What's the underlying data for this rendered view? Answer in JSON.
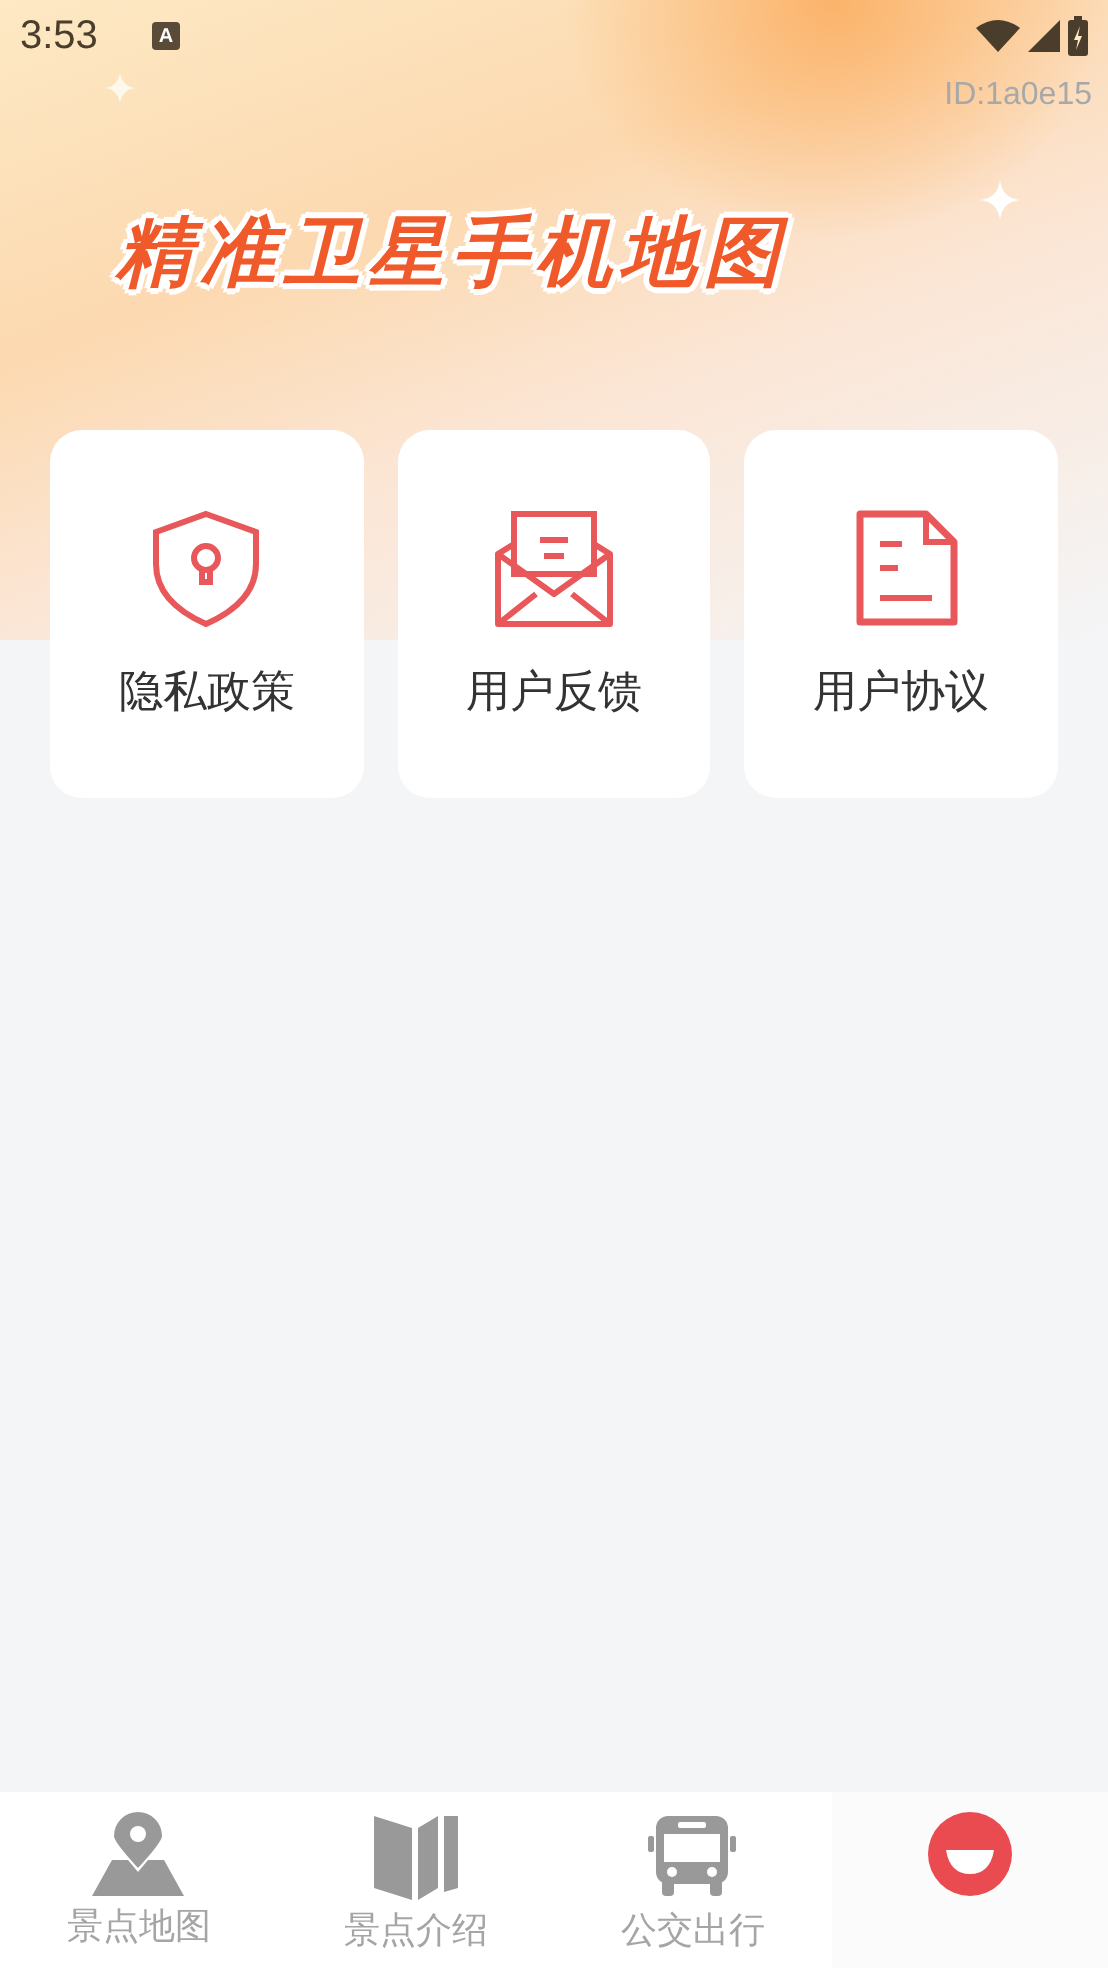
{
  "status_bar": {
    "time": "3:53",
    "notification": "A"
  },
  "device_id": "ID:1a0e15",
  "banner": {
    "title": "精准卫星手机地图"
  },
  "cards": [
    {
      "label": "隐私政策",
      "kind": "shield"
    },
    {
      "label": "用户反馈",
      "kind": "mail"
    },
    {
      "label": "用户协议",
      "kind": "document"
    }
  ],
  "tabs": [
    {
      "label": "景点地图",
      "kind": "map",
      "selected": false
    },
    {
      "label": "景点介绍",
      "kind": "book",
      "selected": false
    },
    {
      "label": "公交出行",
      "kind": "bus",
      "selected": false
    },
    {
      "kind": "profile",
      "selected": true
    }
  ]
}
